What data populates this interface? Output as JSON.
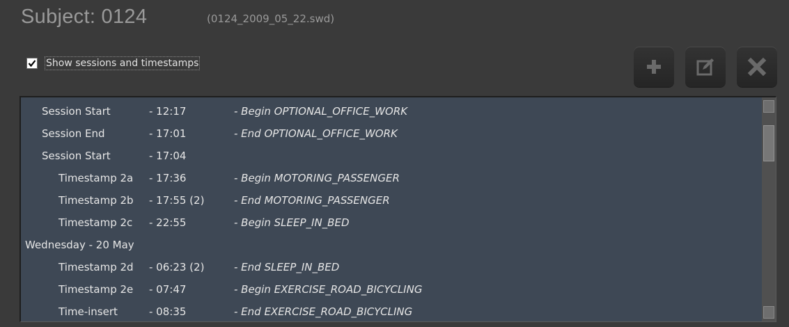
{
  "header": {
    "subject": "Subject: 0124",
    "file": "(0124_2009_05_22.swd)"
  },
  "options": {
    "show_sessions_label": "Show sessions and timestamps",
    "show_sessions_checked": true
  },
  "toolbar": {
    "add_icon": "plus-icon",
    "edit_icon": "edit-icon",
    "delete_icon": "close-icon"
  },
  "list": {
    "rows": [
      {
        "label": "Session Start",
        "time": "- 12:17",
        "event": "- Begin OPTIONAL_OFFICE_WORK"
      },
      {
        "label": "Session End",
        "time": "- 17:01",
        "event": "- End OPTIONAL_OFFICE_WORK"
      },
      {
        "label": "Session Start",
        "time": "- 17:04",
        "event": ""
      },
      {
        "label": "Timestamp 2a",
        "time": "- 17:36",
        "event": "- Begin MOTORING_PASSENGER"
      },
      {
        "label": "Timestamp 2b",
        "time": "- 17:55 (2)",
        "event": "- End MOTORING_PASSENGER"
      },
      {
        "label": "Timestamp 2c",
        "time": "- 22:55",
        "event": "- Begin SLEEP_IN_BED"
      },
      {
        "label": "Wednesday - 20 May",
        "time": "",
        "event": ""
      },
      {
        "label": "Timestamp 2d",
        "time": "- 06:23 (2)",
        "event": "- End SLEEP_IN_BED"
      },
      {
        "label": "Timestamp 2e",
        "time": "- 07:47",
        "event": "- Begin EXERCISE_ROAD_BICYCLING"
      },
      {
        "label": "Time-insert",
        "time": "- 08:35",
        "event": "- End EXERCISE_ROAD_BICYCLING"
      }
    ]
  }
}
